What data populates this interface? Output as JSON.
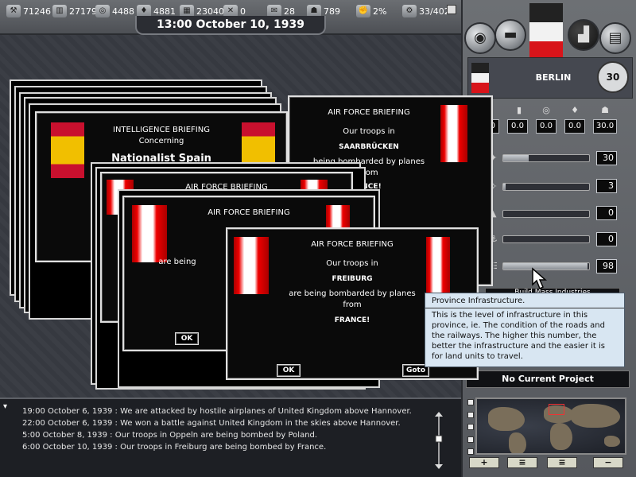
{
  "top_bar": {
    "resources": [
      {
        "icon": "energy-icon",
        "value": "71246"
      },
      {
        "icon": "metal-icon",
        "value": "27179"
      },
      {
        "icon": "rare-materials-icon",
        "value": "4488"
      },
      {
        "icon": "oil-icon",
        "value": "4881"
      },
      {
        "icon": "supplies-icon",
        "value": "23040"
      },
      {
        "icon": "money-icon",
        "value": "0"
      },
      {
        "icon": "transport-icon",
        "value": "28"
      },
      {
        "icon": "manpower-icon",
        "value": "789"
      },
      {
        "icon": "dissent-icon",
        "value": "2%"
      },
      {
        "icon": "ic-icon",
        "value": "33/402"
      }
    ],
    "datetime": "13:00 October 10, 1939"
  },
  "dialogs": {
    "intelligence": {
      "title": "INTELLIGENCE BRIEFING",
      "concerning": "Concerning",
      "country": "Nationalist Spain"
    },
    "air_back": {
      "title": "AIR FORCE BRIEFING",
      "line1": "Our troops in",
      "place": "SAARBRÜCKEN",
      "line2": "being bombarded by planes",
      "line3": "from",
      "attacker": "ANCE!"
    },
    "air_mid1": {
      "title": "AIR FORCE BRIEFING"
    },
    "air_mid2": {
      "title": "AIR FORCE BRIEFING",
      "partial": "are being",
      "ok": "OK"
    },
    "air_front": {
      "title": "AIR FORCE BRIEFING",
      "line1": "Our troops in",
      "place": "FREIBURG",
      "line2": "are being bombarded by planes",
      "line3": "from",
      "attacker": "FRANCE!",
      "ok": "OK",
      "goto": "Goto"
    }
  },
  "province_panel": {
    "city": "BERLIN",
    "star_value": "30",
    "small_values": [
      "0.0",
      "0.0",
      "0.0",
      "0.0",
      "30.0"
    ],
    "sliders": [
      {
        "icon": "aa-icon",
        "value": "30",
        "level": 0.3
      },
      {
        "icon": "radar-icon",
        "value": "3",
        "level": 0.03
      },
      {
        "icon": "fort-icon",
        "value": "0",
        "level": 0.0
      },
      {
        "icon": "naval-base-icon",
        "value": "0",
        "level": 0.0
      },
      {
        "icon": "infrastructure-icon",
        "value": "98",
        "level": 0.98
      }
    ],
    "hidden_label": "Build Mass Industries",
    "project": "No Current Project"
  },
  "tooltip": {
    "title": "Province Infrastructure.",
    "body": "This is the level of infrastructure in this province, ie. The condition of the roads and the railways. The higher this number, the better the infrastructure and the easier it is for land units to travel."
  },
  "log": [
    "19:00 October 6, 1939 : We are attacked by hostile airplanes of United Kingdom above Hannover.",
    "22:00 October 6, 1939 : We won a battle against United Kingdom in the skies above Hannover.",
    "5:00 October 8, 1939 : Our troops in Oppeln are being bombed by Poland.",
    "6:00 October 10, 1939 : Our troops in Freiburg are being bombed by France."
  ],
  "minimap_buttons": [
    "+",
    "≡",
    "≡",
    "−"
  ],
  "colors": {
    "tooltip_bg": "#d8e6f2",
    "dialog_bg": "#0a0a0a",
    "log_bg": "#1d1f24"
  }
}
